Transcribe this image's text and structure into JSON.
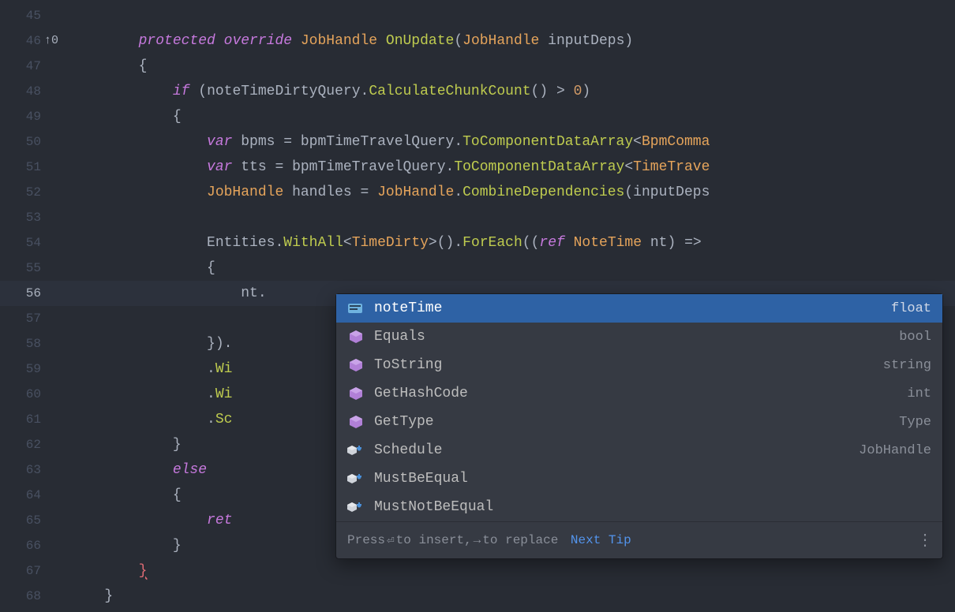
{
  "gutter": {
    "start": 45,
    "end": 68,
    "active": 56,
    "marker_line": 46,
    "marker_text": "↑0"
  },
  "code": {
    "l45": "",
    "l46_mod": "protected override",
    "l46_type": "JobHandle",
    "l46_method": "OnUpdate",
    "l46_paramtype": "JobHandle",
    "l46_paramname": "inputDeps",
    "l47_brace": "{",
    "l48_if": "if",
    "l48_cond_ident": "noteTimeDirtyQuery",
    "l48_call": "CalculateChunkCount",
    "l48_cmp": " > ",
    "l48_zero": "0",
    "l49_brace": "{",
    "l50_var": "var",
    "l50_name": "bpms",
    "l50_eq": " = ",
    "l50_src": "bpmTimeTravelQuery",
    "l50_call": "ToComponentDataArray",
    "l50_gen": "BpmComma",
    "l51_var": "var",
    "l51_name": "tts",
    "l51_eq": " = ",
    "l51_src": "bpmTimeTravelQuery",
    "l51_call": "ToComponentDataArray",
    "l51_gen": "TimeTrave",
    "l52_type": "JobHandle",
    "l52_name": "handles",
    "l52_eq": " = ",
    "l52_src": "JobHandle",
    "l52_call": "CombineDependencies",
    "l52_arg": "inputDeps",
    "l53": "",
    "l54_src": "Entities",
    "l54_wa": "WithAll",
    "l54_gen": "TimeDirty",
    "l54_fe": "ForEach",
    "l54_ref": "ref",
    "l54_pt": "NoteTime",
    "l54_pn": "nt",
    "l54_arrow": " =>",
    "l55_brace": "{",
    "l56_txt": "nt.",
    "l57": "",
    "l58_close": "}).",
    "l59_pre": ".",
    "l59_txt": "Wi",
    "l60_pre": ".",
    "l60_txt": "Wi",
    "l61_pre": ".",
    "l61_txt": "Sc",
    "l62_brace": "}",
    "l63_else": "else",
    "l64_brace": "{",
    "l65_ret": "ret",
    "l66_brace": "}",
    "l67_brace": "}",
    "l68_brace": "}"
  },
  "autocomplete": {
    "items": [
      {
        "icon": "field",
        "label": "noteTime",
        "type": "float",
        "selected": true
      },
      {
        "icon": "method",
        "label": "Equals",
        "type": "bool"
      },
      {
        "icon": "method",
        "label": "ToString",
        "type": "string"
      },
      {
        "icon": "method",
        "label": "GetHashCode",
        "type": "int"
      },
      {
        "icon": "method",
        "label": "GetType",
        "type": "Type"
      },
      {
        "icon": "ext",
        "label": "Schedule",
        "type": "JobHandle"
      },
      {
        "icon": "ext",
        "label": "MustBeEqual",
        "type": ""
      },
      {
        "icon": "ext",
        "label": "MustNotBeEqual",
        "type": ""
      }
    ],
    "footer_press": "Press ",
    "footer_insert": " to insert, ",
    "footer_replace": " to replace",
    "footer_link": "Next Tip",
    "enter_glyph": "⏎",
    "tab_glyph": "→"
  }
}
